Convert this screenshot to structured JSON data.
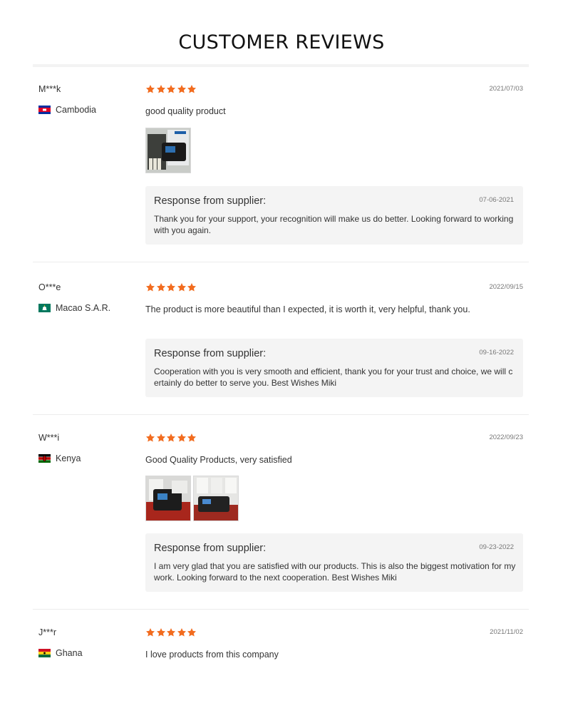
{
  "page": {
    "title": "CUSTOMER REVIEWS"
  },
  "colors": {
    "star": "#f26c1f",
    "response_bg": "#f4f4f4",
    "separator": "#ececec"
  },
  "reviews": [
    {
      "user": "M***k",
      "country": "Cambodia",
      "flag_icon": "cambodia-flag-icon",
      "rating": 5,
      "date": "2021/07/03",
      "comment": "good quality product",
      "photos": 1,
      "response": {
        "title": "Response from supplier:",
        "date": "07-06-2021",
        "text": "Thank you for your support, your recognition will make us do better. Looking forward to working with you again."
      }
    },
    {
      "user": "O***e",
      "country": "Macao S.A.R.",
      "flag_icon": "macao-flag-icon",
      "rating": 5,
      "date": "2022/09/15",
      "comment": "The product is more beautiful than I expected, it is worth it, very helpful, thank you.",
      "photos": 0,
      "response": {
        "title": "Response from supplier:",
        "date": "09-16-2022",
        "text": "Cooperation with you is very smooth and efficient, thank you for your trust and choice, we will certainly do better to serve you. Best Wishes Miki"
      }
    },
    {
      "user": "W***i",
      "country": "Kenya",
      "flag_icon": "kenya-flag-icon",
      "rating": 5,
      "date": "2022/09/23",
      "comment": "Good Quality Products, very satisfied",
      "photos": 2,
      "response": {
        "title": "Response from supplier:",
        "date": "09-23-2022",
        "text": "I am very glad that you are satisfied with our products. This is also the biggest motivation for my work. Looking forward to the next cooperation. Best Wishes Miki"
      }
    },
    {
      "user": "J***r",
      "country": "Ghana",
      "flag_icon": "ghana-flag-icon",
      "rating": 5,
      "date": "2021/11/02",
      "comment": "I love products from this company",
      "photos": 0
    }
  ]
}
